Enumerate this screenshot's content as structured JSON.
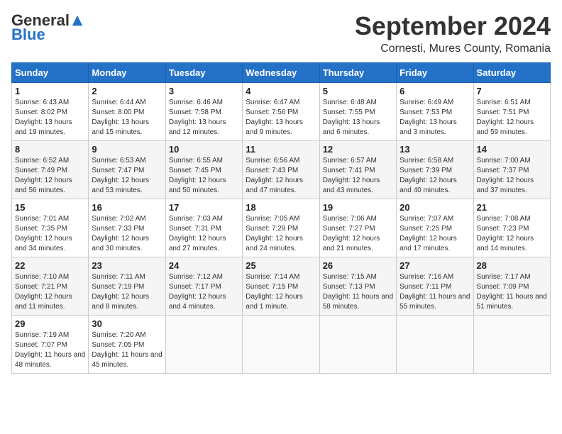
{
  "logo": {
    "general": "General",
    "blue": "Blue"
  },
  "title": "September 2024",
  "location": "Cornesti, Mures County, Romania",
  "headers": [
    "Sunday",
    "Monday",
    "Tuesday",
    "Wednesday",
    "Thursday",
    "Friday",
    "Saturday"
  ],
  "weeks": [
    [
      {
        "day": "1",
        "sunrise": "Sunrise: 6:43 AM",
        "sunset": "Sunset: 8:02 PM",
        "daylight": "Daylight: 13 hours and 19 minutes."
      },
      {
        "day": "2",
        "sunrise": "Sunrise: 6:44 AM",
        "sunset": "Sunset: 8:00 PM",
        "daylight": "Daylight: 13 hours and 15 minutes."
      },
      {
        "day": "3",
        "sunrise": "Sunrise: 6:46 AM",
        "sunset": "Sunset: 7:58 PM",
        "daylight": "Daylight: 13 hours and 12 minutes."
      },
      {
        "day": "4",
        "sunrise": "Sunrise: 6:47 AM",
        "sunset": "Sunset: 7:56 PM",
        "daylight": "Daylight: 13 hours and 9 minutes."
      },
      {
        "day": "5",
        "sunrise": "Sunrise: 6:48 AM",
        "sunset": "Sunset: 7:55 PM",
        "daylight": "Daylight: 13 hours and 6 minutes."
      },
      {
        "day": "6",
        "sunrise": "Sunrise: 6:49 AM",
        "sunset": "Sunset: 7:53 PM",
        "daylight": "Daylight: 13 hours and 3 minutes."
      },
      {
        "day": "7",
        "sunrise": "Sunrise: 6:51 AM",
        "sunset": "Sunset: 7:51 PM",
        "daylight": "Daylight: 12 hours and 59 minutes."
      }
    ],
    [
      {
        "day": "8",
        "sunrise": "Sunrise: 6:52 AM",
        "sunset": "Sunset: 7:49 PM",
        "daylight": "Daylight: 12 hours and 56 minutes."
      },
      {
        "day": "9",
        "sunrise": "Sunrise: 6:53 AM",
        "sunset": "Sunset: 7:47 PM",
        "daylight": "Daylight: 12 hours and 53 minutes."
      },
      {
        "day": "10",
        "sunrise": "Sunrise: 6:55 AM",
        "sunset": "Sunset: 7:45 PM",
        "daylight": "Daylight: 12 hours and 50 minutes."
      },
      {
        "day": "11",
        "sunrise": "Sunrise: 6:56 AM",
        "sunset": "Sunset: 7:43 PM",
        "daylight": "Daylight: 12 hours and 47 minutes."
      },
      {
        "day": "12",
        "sunrise": "Sunrise: 6:57 AM",
        "sunset": "Sunset: 7:41 PM",
        "daylight": "Daylight: 12 hours and 43 minutes."
      },
      {
        "day": "13",
        "sunrise": "Sunrise: 6:58 AM",
        "sunset": "Sunset: 7:39 PM",
        "daylight": "Daylight: 12 hours and 40 minutes."
      },
      {
        "day": "14",
        "sunrise": "Sunrise: 7:00 AM",
        "sunset": "Sunset: 7:37 PM",
        "daylight": "Daylight: 12 hours and 37 minutes."
      }
    ],
    [
      {
        "day": "15",
        "sunrise": "Sunrise: 7:01 AM",
        "sunset": "Sunset: 7:35 PM",
        "daylight": "Daylight: 12 hours and 34 minutes."
      },
      {
        "day": "16",
        "sunrise": "Sunrise: 7:02 AM",
        "sunset": "Sunset: 7:33 PM",
        "daylight": "Daylight: 12 hours and 30 minutes."
      },
      {
        "day": "17",
        "sunrise": "Sunrise: 7:03 AM",
        "sunset": "Sunset: 7:31 PM",
        "daylight": "Daylight: 12 hours and 27 minutes."
      },
      {
        "day": "18",
        "sunrise": "Sunrise: 7:05 AM",
        "sunset": "Sunset: 7:29 PM",
        "daylight": "Daylight: 12 hours and 24 minutes."
      },
      {
        "day": "19",
        "sunrise": "Sunrise: 7:06 AM",
        "sunset": "Sunset: 7:27 PM",
        "daylight": "Daylight: 12 hours and 21 minutes."
      },
      {
        "day": "20",
        "sunrise": "Sunrise: 7:07 AM",
        "sunset": "Sunset: 7:25 PM",
        "daylight": "Daylight: 12 hours and 17 minutes."
      },
      {
        "day": "21",
        "sunrise": "Sunrise: 7:08 AM",
        "sunset": "Sunset: 7:23 PM",
        "daylight": "Daylight: 12 hours and 14 minutes."
      }
    ],
    [
      {
        "day": "22",
        "sunrise": "Sunrise: 7:10 AM",
        "sunset": "Sunset: 7:21 PM",
        "daylight": "Daylight: 12 hours and 11 minutes."
      },
      {
        "day": "23",
        "sunrise": "Sunrise: 7:11 AM",
        "sunset": "Sunset: 7:19 PM",
        "daylight": "Daylight: 12 hours and 8 minutes."
      },
      {
        "day": "24",
        "sunrise": "Sunrise: 7:12 AM",
        "sunset": "Sunset: 7:17 PM",
        "daylight": "Daylight: 12 hours and 4 minutes."
      },
      {
        "day": "25",
        "sunrise": "Sunrise: 7:14 AM",
        "sunset": "Sunset: 7:15 PM",
        "daylight": "Daylight: 12 hours and 1 minute."
      },
      {
        "day": "26",
        "sunrise": "Sunrise: 7:15 AM",
        "sunset": "Sunset: 7:13 PM",
        "daylight": "Daylight: 11 hours and 58 minutes."
      },
      {
        "day": "27",
        "sunrise": "Sunrise: 7:16 AM",
        "sunset": "Sunset: 7:11 PM",
        "daylight": "Daylight: 11 hours and 55 minutes."
      },
      {
        "day": "28",
        "sunrise": "Sunrise: 7:17 AM",
        "sunset": "Sunset: 7:09 PM",
        "daylight": "Daylight: 11 hours and 51 minutes."
      }
    ],
    [
      {
        "day": "29",
        "sunrise": "Sunrise: 7:19 AM",
        "sunset": "Sunset: 7:07 PM",
        "daylight": "Daylight: 11 hours and 48 minutes."
      },
      {
        "day": "30",
        "sunrise": "Sunrise: 7:20 AM",
        "sunset": "Sunset: 7:05 PM",
        "daylight": "Daylight: 11 hours and 45 minutes."
      },
      null,
      null,
      null,
      null,
      null
    ]
  ]
}
